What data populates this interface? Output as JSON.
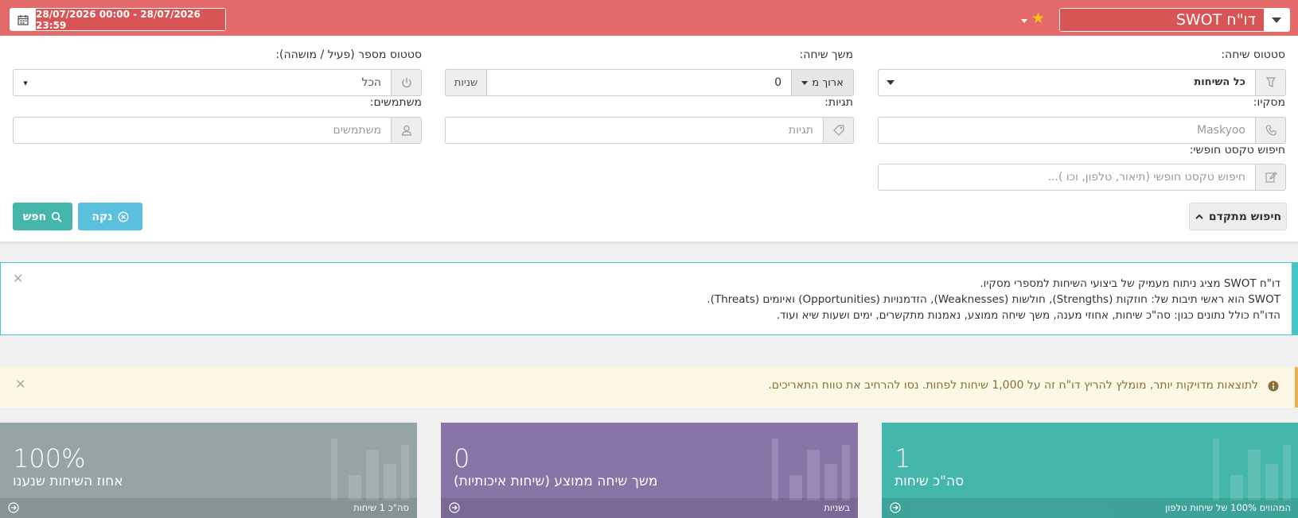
{
  "header": {
    "report_title": "דו\"ח SWOT",
    "date_range": "28/07/2026 00:00 - 28/07/2026 23:59"
  },
  "filters": {
    "call_status": {
      "label": "סטטוס שיחה:",
      "value": "כל השיחות"
    },
    "call_duration": {
      "label": "משך שיחה:",
      "operator": "ארוך מ",
      "value": "0",
      "unit": "שניות"
    },
    "number_status": {
      "label": "סטטוס מספר (פעיל / מושהה):",
      "value": "הכל"
    },
    "maskyoo": {
      "label": "מסקיו:",
      "placeholder": "Maskyoo"
    },
    "tags": {
      "label": "תגיות:",
      "placeholder": "תגיות"
    },
    "users": {
      "label": "משתמשים:",
      "placeholder": "משתמשים"
    },
    "free_text": {
      "label": "חיפוש טקסט חופשי:",
      "placeholder": "חיפוש טקסט חופשי (תיאור, טלפון, וכו )..."
    }
  },
  "buttons": {
    "advanced": "חיפוש מתקדם",
    "clear": "נקה",
    "search": "חפש"
  },
  "info_alert": {
    "lines": [
      "דו\"ח SWOT מציג ניתוח מעמיק של ביצועי השיחות למספרי מסקיו.",
      "SWOT הוא ראשי תיבות של: חוזקות (Strengths), חולשות (Weaknesses), הזדמנויות (Opportunities) ואיומים (Threats).",
      "הדו\"ח כולל נתונים כגון: סה\"כ שיחות, אחוזי מענה, משך שיחה ממוצע, נאמנות מתקשרים, ימים ושעות שיא ועוד."
    ]
  },
  "warning_alert": {
    "text": "לתוצאות מדויקות יותר, מומלץ להריץ דו\"ח זה על 1,000 שיחות לפחות. נסו להרחיב את טווח התאריכים."
  },
  "cards": [
    {
      "value": "1",
      "label": "סה\"כ שיחות",
      "footer": "המהווים 100% של שיחות טלפון",
      "color": "#45b6aa"
    },
    {
      "value": "0",
      "label": "משך שיחה ממוצע (שיחות איכותיות)",
      "footer": "בשניות",
      "color": "#8775a7"
    },
    {
      "value": "100%",
      "label": "אחוז השיחות שנענו",
      "footer": "סה\"כ 1 שיחות",
      "color": "#95a5a6"
    }
  ],
  "colors": {
    "header": "#e46a6a",
    "accent_teal": "#45b6aa",
    "clear_button": "#5bc0de",
    "info_border": "#45c6c6",
    "warning_border": "#f0ad4e"
  }
}
